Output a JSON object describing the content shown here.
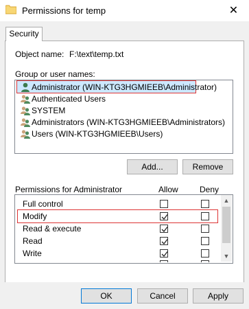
{
  "window": {
    "title": "Permissions for temp",
    "close_glyph": "✕"
  },
  "tabs": [
    {
      "label": "Security"
    }
  ],
  "object": {
    "label": "Object name:",
    "value": "F:\\text\\temp.txt"
  },
  "group": {
    "label": "Group or user names:",
    "items": [
      {
        "label": "Administrator (WIN-KTG3HGMIEEB\\Administrator)",
        "icon": "single-user-icon",
        "selected": true
      },
      {
        "label": "Authenticated Users",
        "icon": "user-group-icon"
      },
      {
        "label": "SYSTEM",
        "icon": "user-group-icon"
      },
      {
        "label": "Administrators (WIN-KTG3HGMIEEB\\Administrators)",
        "icon": "user-group-icon"
      },
      {
        "label": "Users (WIN-KTG3HGMIEEB\\Users)",
        "icon": "user-group-icon"
      }
    ]
  },
  "buttons": {
    "add": "Add...",
    "remove": "Remove",
    "ok": "OK",
    "cancel": "Cancel",
    "apply": "Apply"
  },
  "permissions": {
    "label": "Permissions for Administrator",
    "allow_header": "Allow",
    "deny_header": "Deny",
    "rows": [
      {
        "name": "Full control",
        "allow": false,
        "deny": false
      },
      {
        "name": "Modify",
        "allow": true,
        "deny": false
      },
      {
        "name": "Read & execute",
        "allow": true,
        "deny": false
      },
      {
        "name": "Read",
        "allow": true,
        "deny": false
      },
      {
        "name": "Write",
        "allow": true,
        "deny": false
      }
    ]
  },
  "colors": {
    "highlight_border": "#dd3333",
    "selection": "#cce8ff"
  }
}
